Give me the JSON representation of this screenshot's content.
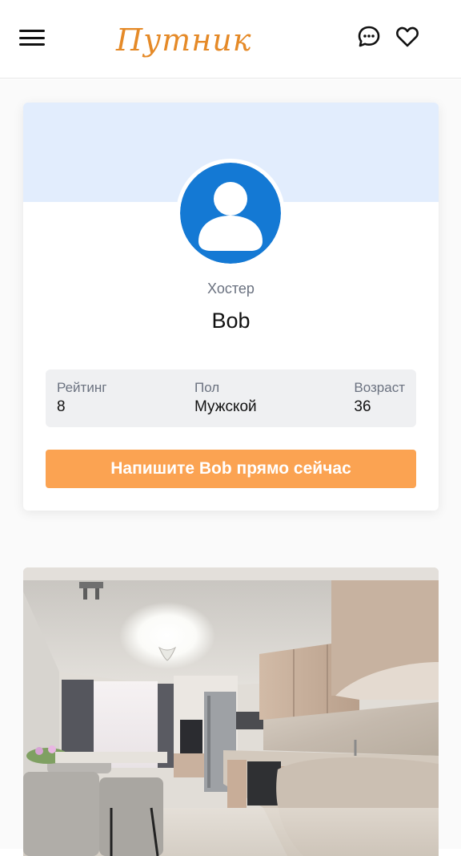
{
  "header": {
    "logo": "Путник",
    "menu_icon": "hamburger-menu-icon",
    "chat_icon": "chat-bubble-icon",
    "favorites_icon": "heart-icon"
  },
  "profile": {
    "role": "Хостер",
    "name": "Bob",
    "avatar_icon": "user-avatar-icon",
    "stats": {
      "rating_label": "Рейтинг",
      "rating_value": "8",
      "gender_label": "Пол",
      "gender_value": "Мужской",
      "age_label": "Возраст",
      "age_value": "36"
    },
    "cta_label": "Напишите Bob прямо сейчас"
  },
  "colors": {
    "brand_orange": "#e58a28",
    "button_orange": "#fba352",
    "avatar_blue": "#1479d4",
    "cover_blue": "#e2edfd"
  },
  "listing": {
    "photo_subject": "apartment-kitchen-living-room-photo"
  }
}
